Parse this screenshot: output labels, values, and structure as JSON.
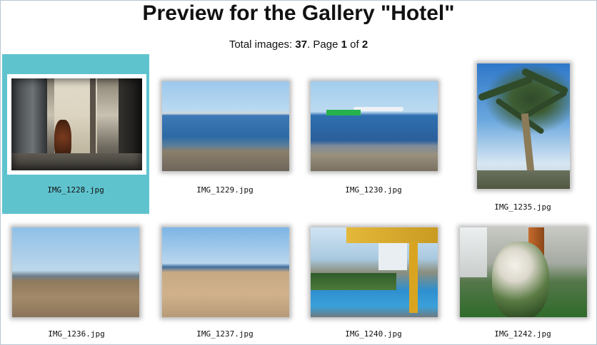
{
  "page": {
    "title": "Preview for the Gallery \"Hotel\"",
    "summary_prefix": "Total images: ",
    "total_images": "37",
    "summary_mid": ". Page ",
    "current_page": "1",
    "summary_of": " of ",
    "total_pages": "2"
  },
  "colors": {
    "selected_background": "#5fc3ce"
  },
  "thumbnails": [
    {
      "caption": "IMG_1228.jpg",
      "selected": true
    },
    {
      "caption": "IMG_1229.jpg",
      "selected": false
    },
    {
      "caption": "IMG_1230.jpg",
      "selected": false
    },
    {
      "caption": "IMG_1235.jpg",
      "selected": false
    },
    {
      "caption": "IMG_1236.jpg",
      "selected": false
    },
    {
      "caption": "IMG_1237.jpg",
      "selected": false
    },
    {
      "caption": "IMG_1240.jpg",
      "selected": false
    },
    {
      "caption": "IMG_1242.jpg",
      "selected": false
    }
  ]
}
